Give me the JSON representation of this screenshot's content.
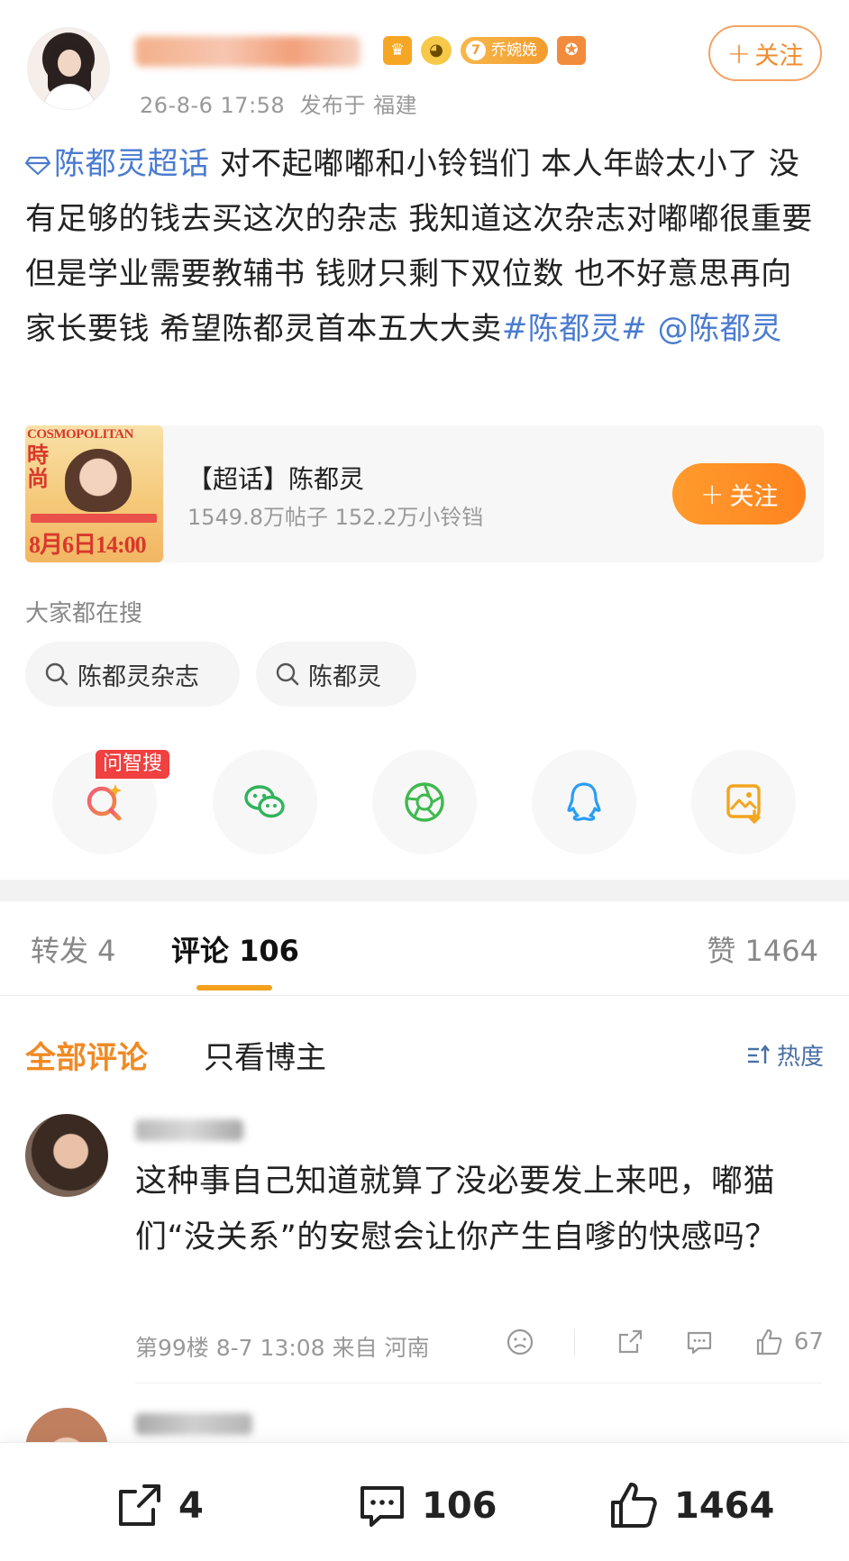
{
  "post": {
    "timestamp": "26-8-6 17:58",
    "location_label": "发布于 福建",
    "follow_label": "关注",
    "badge_level": "7",
    "badge_name": "乔婉娩",
    "topic_link": "陈都灵超话",
    "text_main": " 对不起嘟嘟和小铃铛们 本人年龄太小了 没有足够的钱去买这次的杂志 我知道这次杂志对嘟嘟很重要 但是学业需要教辅书 钱财只剩下双位数 也不好意思再向家长要钱 希望陈都灵首本五大大卖",
    "hashtag": "#陈都灵#",
    "mention": " @陈都灵"
  },
  "topic_card": {
    "cover_brand": "COSMOPOLITAN",
    "cover_cn": "時尚",
    "cover_date": "8月6日14:00",
    "name": "【超话】陈都灵",
    "stats": "1549.8万帖子 152.2万小铃铛",
    "follow_label": "关注"
  },
  "search": {
    "heading": "大家都在搜",
    "chips": [
      "陈都灵杂志",
      "陈都灵"
    ]
  },
  "share": {
    "ask_tag": "问智搜",
    "icons": [
      "ai-search-icon",
      "wechat-icon",
      "moments-icon",
      "qq-icon",
      "save-image-icon"
    ]
  },
  "tabs": {
    "repost": "转发 4",
    "comment": "评论 106",
    "like": "赞 1464"
  },
  "filters": {
    "all": "全部评论",
    "author_only": "只看博主",
    "sort": "热度"
  },
  "comment": {
    "text": "这种事自己知道就算了没必要发上来吧，嘟猫们“没关系”的安慰会让你产生自嗲的快感吗？",
    "meta": "第99楼 8-7 13:08 来自 河南",
    "likes": "67"
  },
  "bottom_bar": {
    "repost_count": "4",
    "comment_count": "106",
    "like_count": "1464"
  },
  "colors": {
    "accent_orange": "#f08a24",
    "link_blue": "#4a7bd0",
    "ask_red": "#f04040"
  }
}
